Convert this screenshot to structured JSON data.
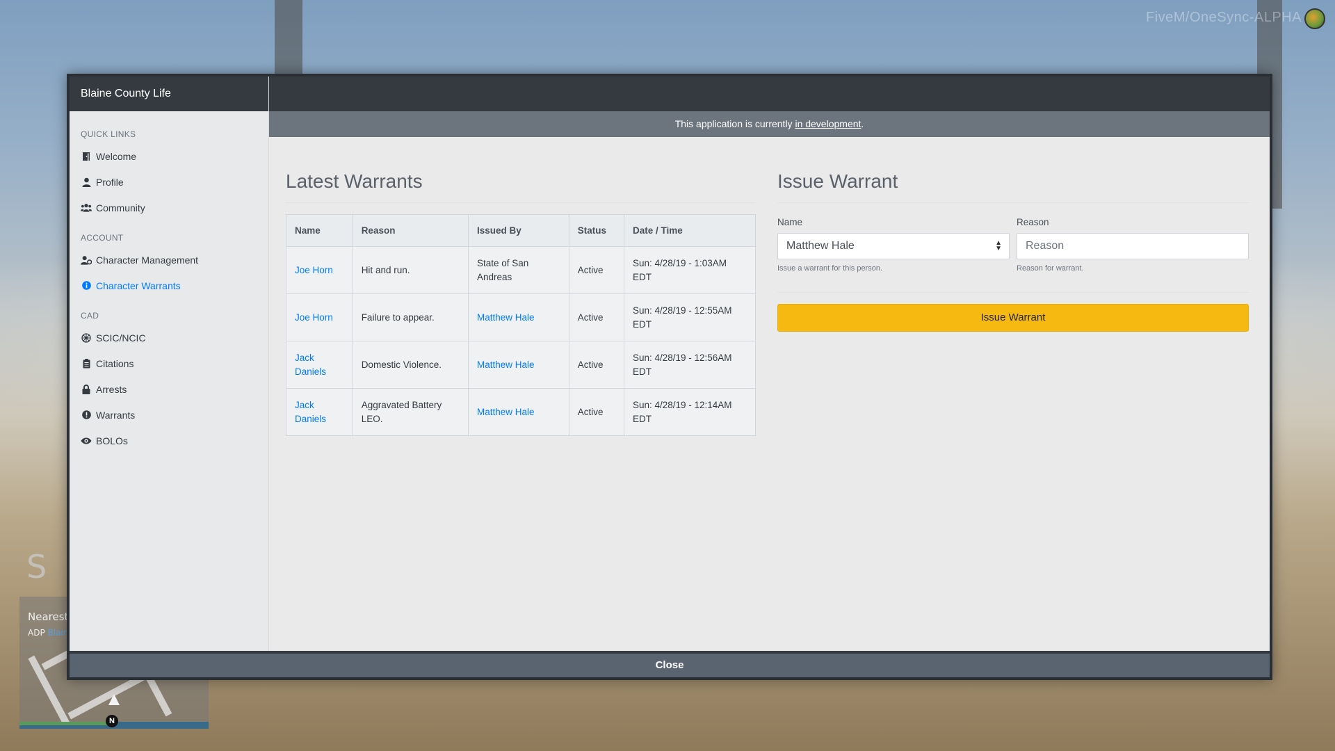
{
  "overlay": {
    "watermark": "FiveM/OneSync-ALPHA",
    "hud": {
      "zone_letter": "S",
      "postal_label": "Nearest Postal",
      "area_prefix": "ADP",
      "area_name": "Blaine",
      "compass": "N"
    }
  },
  "app": {
    "brand": "Blaine County Life",
    "dev_notice_prefix": "This application is currently",
    "dev_notice_link": "in development",
    "dev_notice_suffix": ".",
    "close_label": "Close"
  },
  "sidebar": {
    "sections": [
      {
        "heading": "QUICK LINKS",
        "items": [
          {
            "label": "Welcome",
            "icon": "door-icon",
            "active": false
          },
          {
            "label": "Profile",
            "icon": "user-icon",
            "active": false
          },
          {
            "label": "Community",
            "icon": "users-icon",
            "active": false
          }
        ]
      },
      {
        "heading": "ACCOUNT",
        "items": [
          {
            "label": "Character Management",
            "icon": "user-cog-icon",
            "active": false
          },
          {
            "label": "Character Warrants",
            "icon": "info-circle-icon",
            "active": true
          }
        ]
      },
      {
        "heading": "CAD",
        "items": [
          {
            "label": "SCIC/NCIC",
            "icon": "network-icon",
            "active": false
          },
          {
            "label": "Citations",
            "icon": "clipboard-icon",
            "active": false
          },
          {
            "label": "Arrests",
            "icon": "lock-icon",
            "active": false
          },
          {
            "label": "Warrants",
            "icon": "exclamation-circle-icon",
            "active": false
          },
          {
            "label": "BOLOs",
            "icon": "eye-icon",
            "active": false
          }
        ]
      }
    ]
  },
  "warrants": {
    "title": "Latest Warrants",
    "columns": [
      "Name",
      "Reason",
      "Issued By",
      "Status",
      "Date / Time"
    ],
    "rows": [
      {
        "name": "Joe Horn",
        "reason": "Hit and run.",
        "issued_by": "State of San Andreas",
        "issued_by_link": false,
        "status": "Active",
        "datetime": "Sun: 4/28/19 - 1:03AM EDT"
      },
      {
        "name": "Joe Horn",
        "reason": "Failure to appear.",
        "issued_by": "Matthew Hale",
        "issued_by_link": true,
        "status": "Active",
        "datetime": "Sun: 4/28/19 - 12:55AM EDT"
      },
      {
        "name": "Jack Daniels",
        "reason": "Domestic Violence.",
        "issued_by": "Matthew Hale",
        "issued_by_link": true,
        "status": "Active",
        "datetime": "Sun: 4/28/19 - 12:56AM EDT"
      },
      {
        "name": "Jack Daniels",
        "reason": "Aggravated Battery LEO.",
        "issued_by": "Matthew Hale",
        "issued_by_link": true,
        "status": "Active",
        "datetime": "Sun: 4/28/19 - 12:14AM EDT"
      }
    ]
  },
  "issue_form": {
    "title": "Issue Warrant",
    "name_label": "Name",
    "name_value": "Matthew Hale",
    "name_help": "Issue a warrant for this person.",
    "reason_label": "Reason",
    "reason_placeholder": "Reason",
    "reason_help": "Reason for warrant.",
    "submit_label": "Issue Warrant"
  },
  "colors": {
    "accent": "#007bff",
    "warning": "#f5b911",
    "dark": "#343a40",
    "secondary": "#6c757d"
  }
}
